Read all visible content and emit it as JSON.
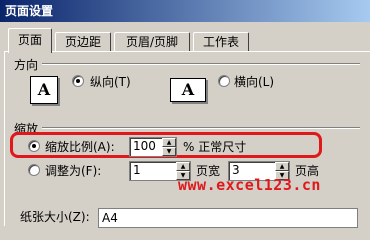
{
  "window": {
    "title": "页面设置"
  },
  "tabs": [
    {
      "label": "页面"
    },
    {
      "label": "页边距"
    },
    {
      "label": "页眉/页脚"
    },
    {
      "label": "工作表"
    }
  ],
  "orientation": {
    "group_label": "方向",
    "portrait_label": "纵向(T)",
    "landscape_label": "横向(L)",
    "icon_letter": "A",
    "selected": "portrait"
  },
  "scaling": {
    "group_label": "缩放",
    "adjust_label": "缩放比例(A):",
    "adjust_value": "100",
    "adjust_suffix": "% 正常尺寸",
    "fit_label": "调整为(F):",
    "fit_wide_value": "1",
    "fit_wide_label": "页宽",
    "fit_tall_value": "3",
    "fit_tall_label": "页高",
    "selected": "adjust"
  },
  "paper": {
    "label": "纸张大小(Z):",
    "value": "A4"
  },
  "watermark": "www.excel123.cn",
  "colors": {
    "highlight": "#e0181b",
    "title_bar": "#0a246a"
  }
}
